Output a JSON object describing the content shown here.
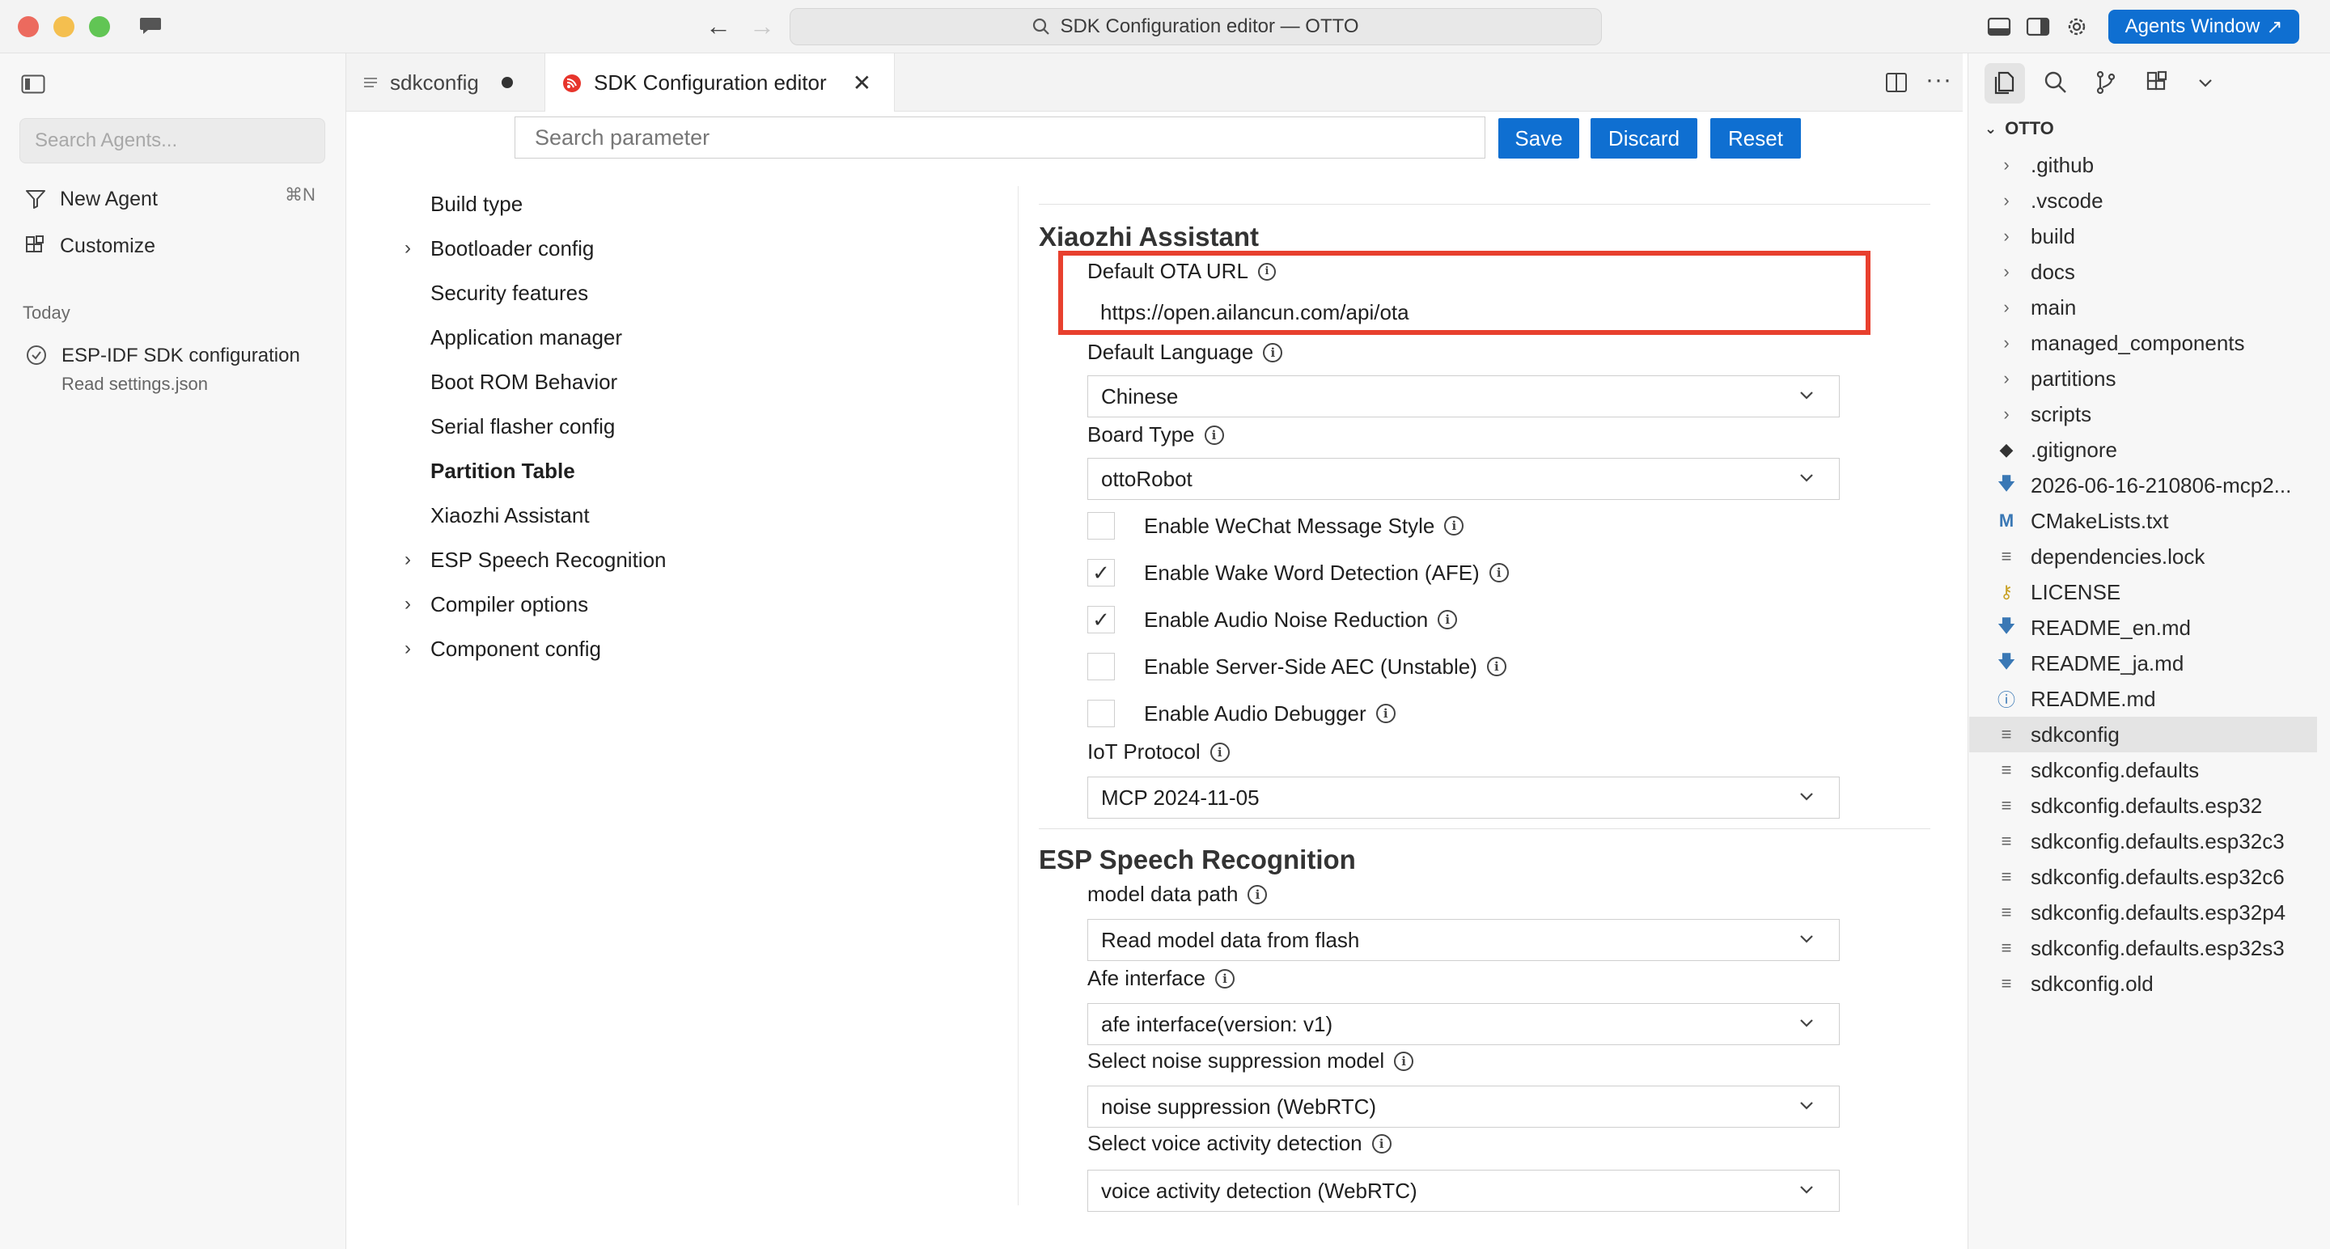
{
  "window": {
    "title": "SDK Configuration editor — OTTO",
    "agents_button": "Agents Window"
  },
  "agents_sidebar": {
    "search_placeholder": "Search Agents...",
    "new_agent": "New Agent",
    "new_agent_shortcut": "⌘N",
    "customize": "Customize",
    "section_today": "Today",
    "session_title": "ESP-IDF SDK configuration",
    "session_subtitle": "Read settings.json"
  },
  "tabs": [
    {
      "label": "sdkconfig",
      "modified": true
    },
    {
      "label": "SDK Configuration editor",
      "active": true
    }
  ],
  "toolbar": {
    "search_placeholder": "Search parameter",
    "save": "Save",
    "discard": "Discard",
    "reset": "Reset"
  },
  "tree": [
    {
      "label": "Build type",
      "expandable": false
    },
    {
      "label": "Bootloader config",
      "expandable": true
    },
    {
      "label": "Security features",
      "expandable": false
    },
    {
      "label": "Application manager",
      "expandable": false
    },
    {
      "label": "Boot ROM Behavior",
      "expandable": false
    },
    {
      "label": "Serial flasher config",
      "expandable": false
    },
    {
      "label": "Partition Table",
      "expandable": false,
      "bold": true
    },
    {
      "label": "Xiaozhi Assistant",
      "expandable": false
    },
    {
      "label": "ESP Speech Recognition",
      "expandable": true
    },
    {
      "label": "Compiler options",
      "expandable": true
    },
    {
      "label": "Component config",
      "expandable": true
    }
  ],
  "xiaozhi": {
    "heading": "Xiaozhi Assistant",
    "ota_label": "Default OTA URL",
    "ota_value": "https://open.ailancun.com/api/ota",
    "language_label": "Default Language",
    "language_value": "Chinese",
    "board_label": "Board Type",
    "board_value": "ottoRobot",
    "checks": [
      {
        "label": "Enable WeChat Message Style",
        "checked": false
      },
      {
        "label": "Enable Wake Word Detection (AFE)",
        "checked": true
      },
      {
        "label": "Enable Audio Noise Reduction",
        "checked": true
      },
      {
        "label": "Enable Server-Side AEC (Unstable)",
        "checked": false
      },
      {
        "label": "Enable Audio Debugger",
        "checked": false
      }
    ],
    "iot_label": "IoT Protocol",
    "iot_value": "MCP 2024-11-05"
  },
  "speech": {
    "heading": "ESP Speech Recognition",
    "model_label": "model data path",
    "model_value": "Read model data from flash",
    "afe_label": "Afe interface",
    "afe_value": "afe interface(version: v1)",
    "ns_label": "Select noise suppression model",
    "ns_value": "noise suppression (WebRTC)",
    "vad_label": "Select voice activity detection",
    "vad_value": "voice activity detection (WebRTC)"
  },
  "explorer": {
    "root": "OTTO",
    "items": [
      {
        "label": ".github",
        "type": "folder"
      },
      {
        "label": ".vscode",
        "type": "folder"
      },
      {
        "label": "build",
        "type": "folder"
      },
      {
        "label": "docs",
        "type": "folder"
      },
      {
        "label": "main",
        "type": "folder"
      },
      {
        "label": "managed_components",
        "type": "folder"
      },
      {
        "label": "partitions",
        "type": "folder"
      },
      {
        "label": "scripts",
        "type": "folder"
      },
      {
        "label": ".gitignore",
        "type": "git"
      },
      {
        "label": "2026-06-16-210806-mcp2...",
        "type": "markdown"
      },
      {
        "label": "CMakeLists.txt",
        "type": "cmake"
      },
      {
        "label": "dependencies.lock",
        "type": "file"
      },
      {
        "label": "LICENSE",
        "type": "license"
      },
      {
        "label": "README_en.md",
        "type": "markdown"
      },
      {
        "label": "README_ja.md",
        "type": "markdown"
      },
      {
        "label": "README.md",
        "type": "info"
      },
      {
        "label": "sdkconfig",
        "type": "file",
        "selected": true
      },
      {
        "label": "sdkconfig.defaults",
        "type": "file"
      },
      {
        "label": "sdkconfig.defaults.esp32",
        "type": "file"
      },
      {
        "label": "sdkconfig.defaults.esp32c3",
        "type": "file"
      },
      {
        "label": "sdkconfig.defaults.esp32c6",
        "type": "file"
      },
      {
        "label": "sdkconfig.defaults.esp32p4",
        "type": "file"
      },
      {
        "label": "sdkconfig.defaults.esp32s3",
        "type": "file"
      },
      {
        "label": "sdkconfig.old",
        "type": "file"
      }
    ]
  },
  "colors": {
    "accent": "#0f6fd1",
    "highlight_box": "#e8402e"
  }
}
